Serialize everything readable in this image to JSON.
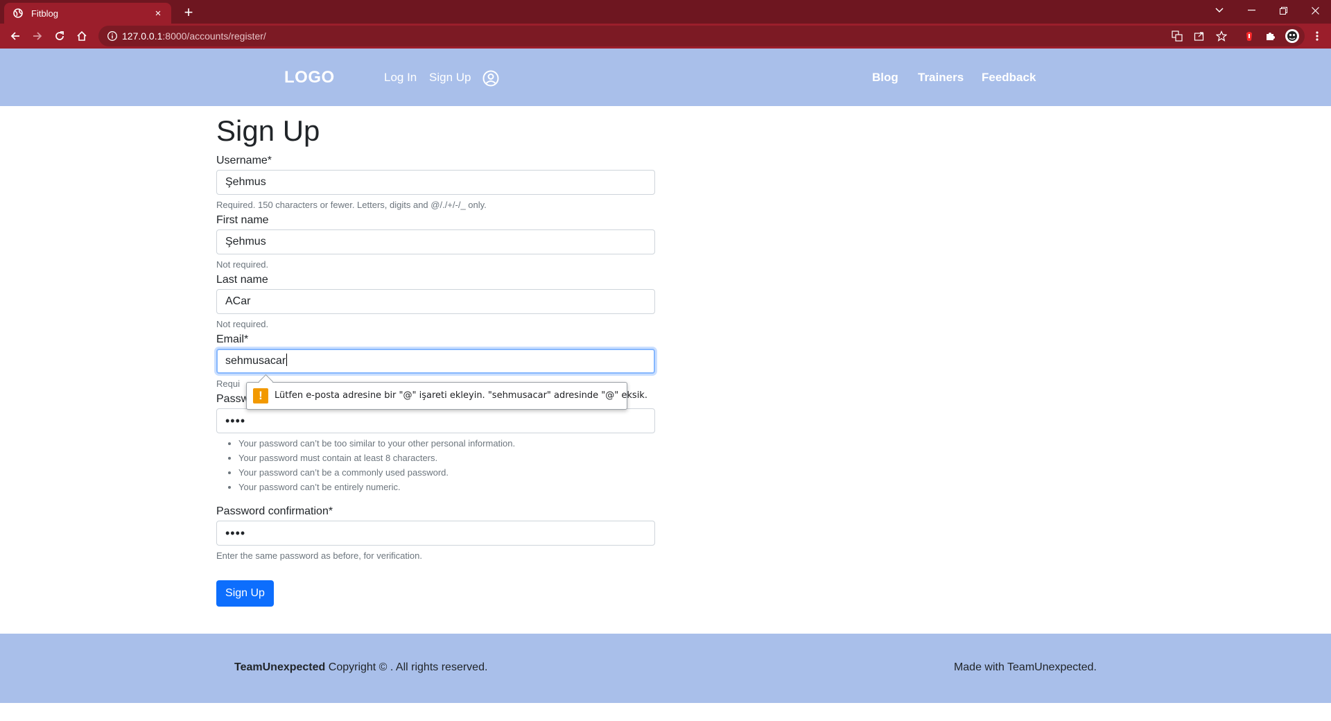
{
  "browser": {
    "tab_title": "Fitblog",
    "url_host": "127.0.0.1",
    "url_rest": ":8000/accounts/register/",
    "new_tab": "+",
    "close_tab": "×"
  },
  "header": {
    "logo": "LOGO",
    "nav_left": [
      "Log In",
      "Sign Up"
    ],
    "nav_right": [
      "Blog",
      "Trainers",
      "Feedback"
    ]
  },
  "form": {
    "title": "Sign Up",
    "username": {
      "label": "Username*",
      "value": "Şehmus",
      "help": "Required. 150 characters or fewer. Letters, digits and @/./+/-/_ only."
    },
    "first_name": {
      "label": "First name",
      "value": "Şehmus",
      "help": "Not required."
    },
    "last_name": {
      "label": "Last name",
      "value": "ACar",
      "help": "Not required."
    },
    "email": {
      "label": "Email*",
      "value": "sehmusacar",
      "help": "Requi"
    },
    "password": {
      "label": "Passw",
      "value": "••••",
      "rules": [
        "Your password can’t be too similar to your other personal information.",
        "Your password must contain at least 8 characters.",
        "Your password can’t be a commonly used password.",
        "Your password can’t be entirely numeric."
      ]
    },
    "password_confirm": {
      "label": "Password confirmation*",
      "value": "••••",
      "help": "Enter the same password as before, for verification."
    },
    "submit": "Sign Up"
  },
  "validation": {
    "icon": "!",
    "message": "Lütfen e-posta adresine bir \"@\" işareti ekleyin. \"sehmusacar\" adresinde \"@\" eksik."
  },
  "footer": {
    "brand": "TeamUnexpected",
    "copyright": " Copyright © . All rights reserved.",
    "made_with": "Made with TeamUnexpected."
  },
  "colors": {
    "tabbar": "#6e1620",
    "toolbar": "#9b1e2b",
    "site_bar": "#a9bfea",
    "primary_button": "#0d6efd"
  }
}
